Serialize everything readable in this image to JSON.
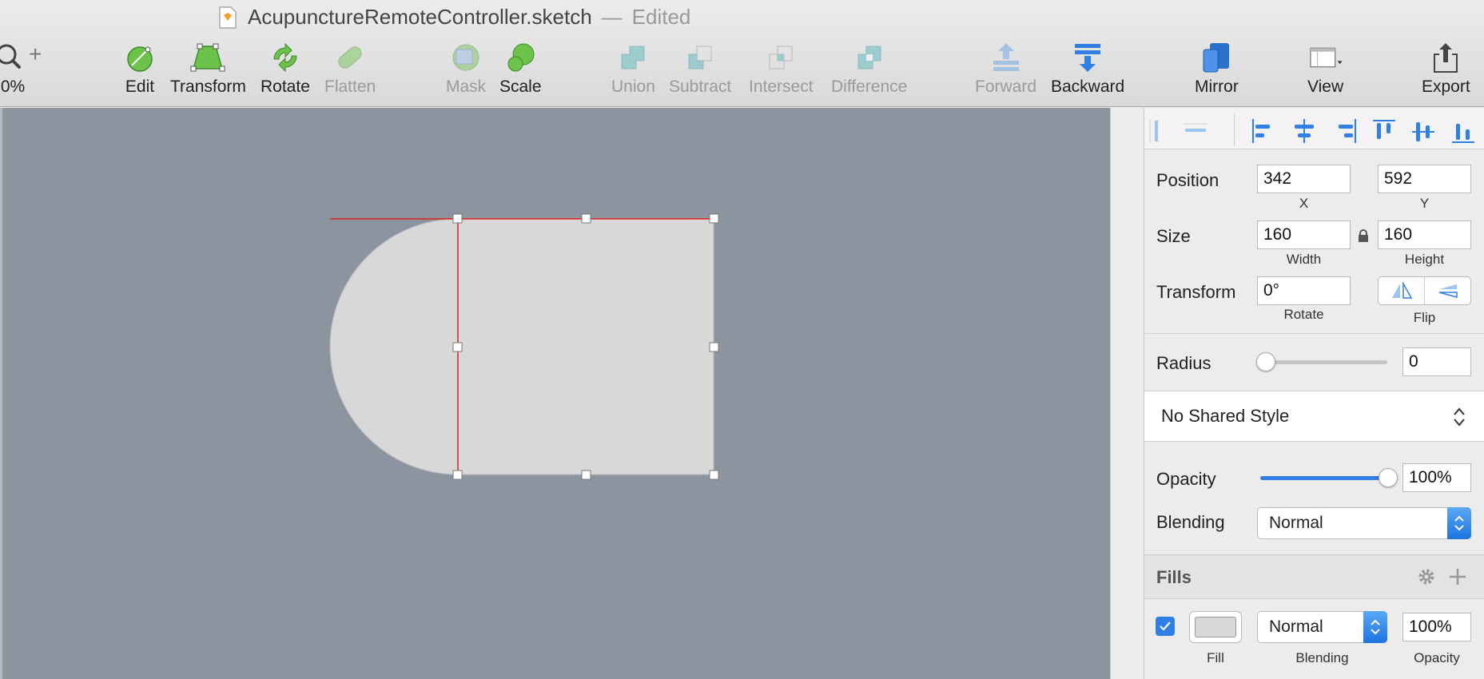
{
  "window": {
    "doc_title": "AcupunctureRemoteController.sketch",
    "separator": "—",
    "edited_label": "Edited"
  },
  "toolbar": {
    "zoom_value": "0%",
    "zoom_in_label": "+",
    "edit": "Edit",
    "transform": "Transform",
    "rotate": "Rotate",
    "flatten": "Flatten",
    "mask": "Mask",
    "scale": "Scale",
    "union": "Union",
    "subtract": "Subtract",
    "intersect": "Intersect",
    "difference": "Difference",
    "forward": "Forward",
    "backward": "Backward",
    "mirror": "Mirror",
    "view": "View",
    "export": "Export"
  },
  "inspector": {
    "position": {
      "label": "Position",
      "x": "342",
      "y": "592",
      "x_label": "X",
      "y_label": "Y"
    },
    "size": {
      "label": "Size",
      "width": "160",
      "height": "160",
      "width_label": "Width",
      "height_label": "Height"
    },
    "transform": {
      "label": "Transform",
      "rotate_value": "0°",
      "rotate_label": "Rotate",
      "flip_label": "Flip"
    },
    "radius": {
      "label": "Radius",
      "value": "0",
      "slider_level": 0
    },
    "shared_style": {
      "value": "No Shared Style"
    },
    "opacity": {
      "label": "Opacity",
      "value": "100%",
      "slider_level": 1.0
    },
    "blending": {
      "label": "Blending",
      "value": "Normal"
    },
    "fills": {
      "title": "Fills",
      "enabled": true,
      "swatch_color": "#d8d8d8",
      "blending_value": "Normal",
      "opacity_value": "100%",
      "fill_label": "Fill",
      "blending_label": "Blending",
      "opacity_label": "Opacity"
    }
  },
  "colors": {
    "canvas_bg": "#8c949f",
    "shape_fill": "#d8d8d8",
    "guide_red": "#e02020",
    "accent_blue": "#2f7fe6"
  }
}
